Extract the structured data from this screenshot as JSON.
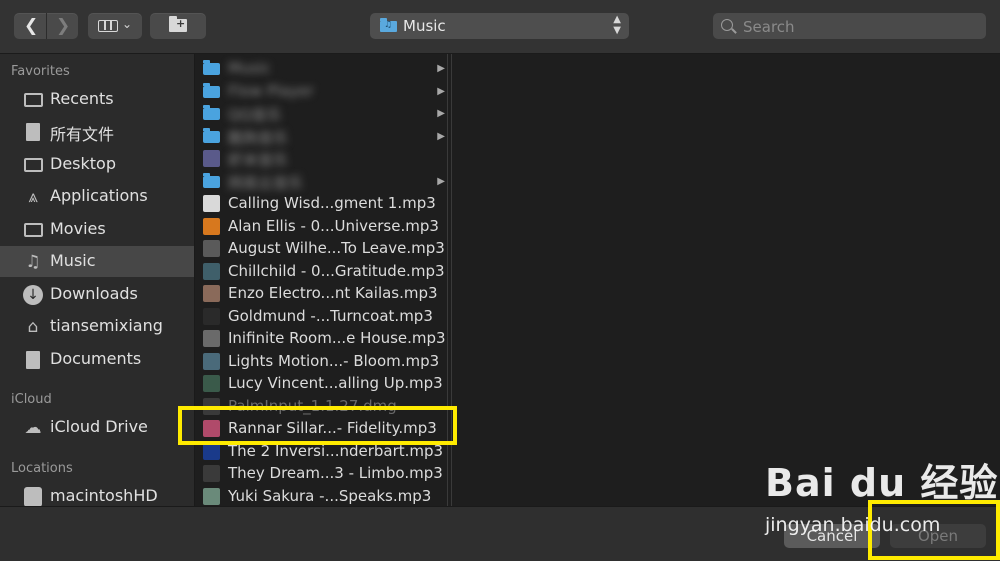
{
  "toolbar": {
    "location": "Music",
    "search_placeholder": "Search"
  },
  "sidebar": {
    "favorites_header": "Favorites",
    "favorites": [
      {
        "label": "Recents",
        "icon": "recents-icon"
      },
      {
        "label": "所有文件",
        "icon": "all-files-icon"
      },
      {
        "label": "Desktop",
        "icon": "desktop-icon"
      },
      {
        "label": "Applications",
        "icon": "applications-icon"
      },
      {
        "label": "Movies",
        "icon": "movies-icon"
      },
      {
        "label": "Music",
        "icon": "music-icon",
        "selected": true
      },
      {
        "label": "Downloads",
        "icon": "downloads-icon"
      },
      {
        "label": "tiansemixiang",
        "icon": "home-icon"
      },
      {
        "label": "Documents",
        "icon": "documents-icon"
      }
    ],
    "icloud_header": "iCloud",
    "icloud": [
      {
        "label": "iCloud Drive",
        "icon": "cloud-icon"
      }
    ],
    "locations_header": "Locations",
    "locations": [
      {
        "label": "macintoshHD",
        "icon": "disk-icon"
      }
    ]
  },
  "files": [
    {
      "name": "Music",
      "kind": "folder",
      "blurred": true
    },
    {
      "name": "Flow Player",
      "kind": "folder",
      "blurred": true
    },
    {
      "name": "QQ音乐",
      "kind": "folder",
      "blurred": true
    },
    {
      "name": "酷狗音乐",
      "kind": "folder",
      "blurred": true
    },
    {
      "name": "虾米音乐",
      "kind": "app",
      "blurred": true
    },
    {
      "name": "网易云音乐",
      "kind": "folder",
      "blurred": true
    },
    {
      "name": "Calling Wisd...gment 1.mp3",
      "kind": "doc"
    },
    {
      "name": "Alan Ellis - 0...Universe.mp3",
      "kind": "art",
      "color": "#d7781e"
    },
    {
      "name": "August Wilhe...To Leave.mp3",
      "kind": "art",
      "color": "#5a5a5a"
    },
    {
      "name": "Chillchild - 0...Gratitude.mp3",
      "kind": "art",
      "color": "#3f5f6a"
    },
    {
      "name": "Enzo Electro...nt Kailas.mp3",
      "kind": "art",
      "color": "#8a6a5a"
    },
    {
      "name": "Goldmund -...Turncoat.mp3",
      "kind": "art",
      "color": "#2a2a2a"
    },
    {
      "name": "Inifinite Room...e House.mp3",
      "kind": "art",
      "color": "#6a6a6a"
    },
    {
      "name": "Lights Motion...- Bloom.mp3",
      "kind": "art",
      "color": "#4a6a7a"
    },
    {
      "name": "Lucy Vincent...alling Up.mp3",
      "kind": "art",
      "color": "#3a5a4a"
    },
    {
      "name": "PalmInput_1.1.27.dmg",
      "kind": "dim"
    },
    {
      "name": "Rannar Sillar...- Fidelity.mp3",
      "kind": "art",
      "color": "#b04a6a"
    },
    {
      "name": "The 2 Inversi...nderbart.mp3",
      "kind": "art",
      "color": "#1a3a8a"
    },
    {
      "name": "They Dream...3 - Limbo.mp3",
      "kind": "art",
      "color": "#3a3a3a"
    },
    {
      "name": "Yuki Sakura -...Speaks.mp3",
      "kind": "art",
      "color": "#6a8a7a"
    }
  ],
  "buttons": {
    "cancel": "Cancel",
    "open": "Open"
  },
  "watermark": {
    "brand": "Bai du 经验",
    "url": "jingyan.baidu.com"
  }
}
